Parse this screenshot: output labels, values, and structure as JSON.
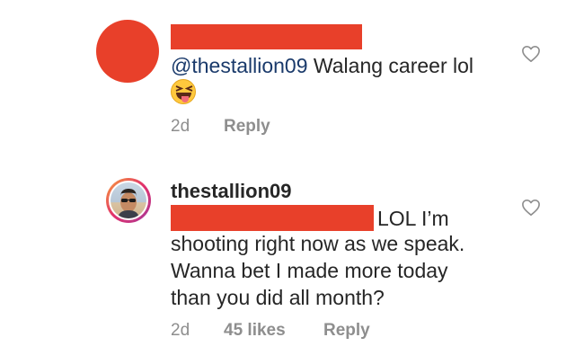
{
  "comments": [
    {
      "mention": "@thestallion09",
      "text": " Walang career lol",
      "emoji": "squinting-face-with-tongue",
      "time": "2d",
      "reply": "Reply"
    },
    {
      "username": "thestallion09",
      "line1": "LOL I’m",
      "line2": "shooting right now as we speak.",
      "line3": "Wanna bet I made more today",
      "line4": "than you did all month?",
      "time": "2d",
      "likes": "45 likes",
      "reply": "Reply"
    }
  ],
  "colors": {
    "redaction": "#e8402a",
    "mention": "#1a3a6b",
    "meta": "#8e8e8e"
  },
  "icons": [
    "heart-icon"
  ]
}
